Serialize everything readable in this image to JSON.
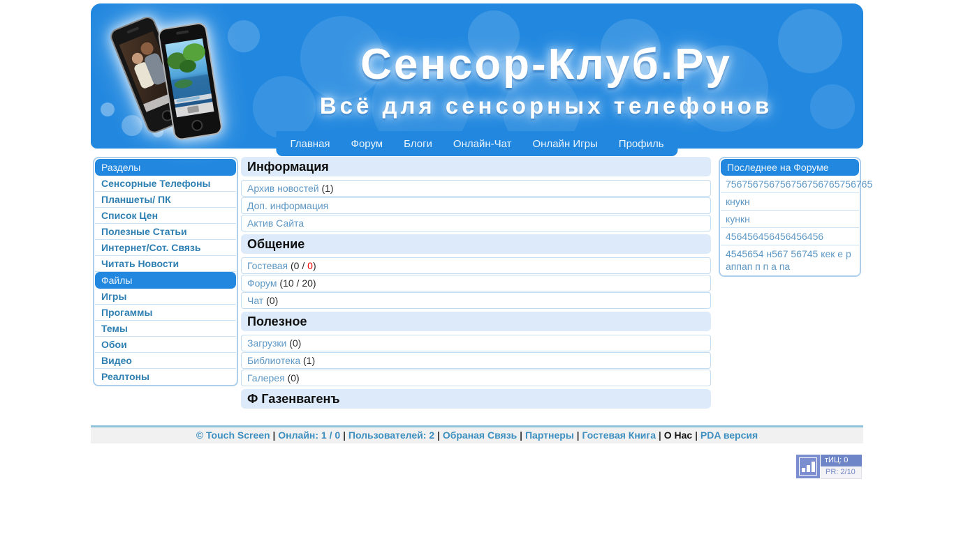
{
  "colors": {
    "accent_blue": "#2288DF",
    "section_header_bg": "#DCEAF9",
    "link_blue": "#5D97C4",
    "sidebar_link_blue": "#2E7FB2",
    "red_count": "#F00000",
    "badge_blue": "#6E86C8"
  },
  "header": {
    "title": "Сенсор-Клуб.Ру",
    "subtitle": "Всё для сенсорных телефонов",
    "nav": [
      "Главная",
      "Форум",
      "Блоги",
      "Онлайн-Чат",
      "Онлайн Игры",
      "Профиль"
    ]
  },
  "sidebar_left": {
    "groups": [
      {
        "title": "Разделы",
        "items": [
          "Сенсорные Телефоны",
          "Планшеты/ ПК",
          "Список Цен",
          "Полезные Статьи",
          "Интернет/Сот. Связь",
          "Читать Новости"
        ]
      },
      {
        "title": "Файлы",
        "items": [
          "Игры",
          "Прогаммы",
          "Темы",
          "Обои",
          "Видео",
          "Реалтоны"
        ]
      }
    ]
  },
  "main": {
    "sections": [
      {
        "title": "Информация",
        "rows": [
          {
            "link": "Архив новостей",
            "after": [
              {
                "text": "(1)"
              }
            ]
          },
          {
            "link": "Доп. информация",
            "after": []
          },
          {
            "link": "Актив Сайта",
            "after": []
          }
        ]
      },
      {
        "title": "Общение",
        "rows": [
          {
            "link": "Гостевая",
            "after": [
              {
                "text": "(0 / "
              },
              {
                "text": "0",
                "red": true
              },
              {
                "text": ")"
              }
            ]
          },
          {
            "link": "Форум",
            "after": [
              {
                "text": "(10 / 20)"
              }
            ]
          },
          {
            "link": "Чат",
            "after": [
              {
                "text": "(0)"
              }
            ]
          }
        ]
      },
      {
        "title": "Полезное",
        "rows": [
          {
            "link": "Загрузки",
            "after": [
              {
                "text": "(0)"
              }
            ]
          },
          {
            "link": "Библиотека",
            "after": [
              {
                "text": "(1)"
              }
            ]
          },
          {
            "link": "Галерея",
            "after": [
              {
                "text": "(0)"
              }
            ]
          }
        ]
      }
    ],
    "extra_header": "Ф Газенвагенъ"
  },
  "sidebar_right": {
    "title": "Последнее на Форуме",
    "items": [
      "756756756756756756765756765",
      "кнукн",
      "кункн",
      "456456456456456456",
      "4545654 н567 56745 кек е р аппап п п а па"
    ]
  },
  "footer": {
    "separator": "|",
    "items": [
      {
        "text": "© Touch Screen"
      },
      {
        "text": "Онлайн: 1 / 0"
      },
      {
        "text": "Пользователей: 2"
      },
      {
        "text": "Обраная Связь"
      },
      {
        "text": "Партнеры"
      },
      {
        "text": "Гостевая Книга"
      },
      {
        "text": "О Нас",
        "dark": true
      },
      {
        "text": "PDA версия"
      }
    ]
  },
  "badge": {
    "tic": "тИЦ: 0",
    "pr": "PR: 2/10"
  }
}
